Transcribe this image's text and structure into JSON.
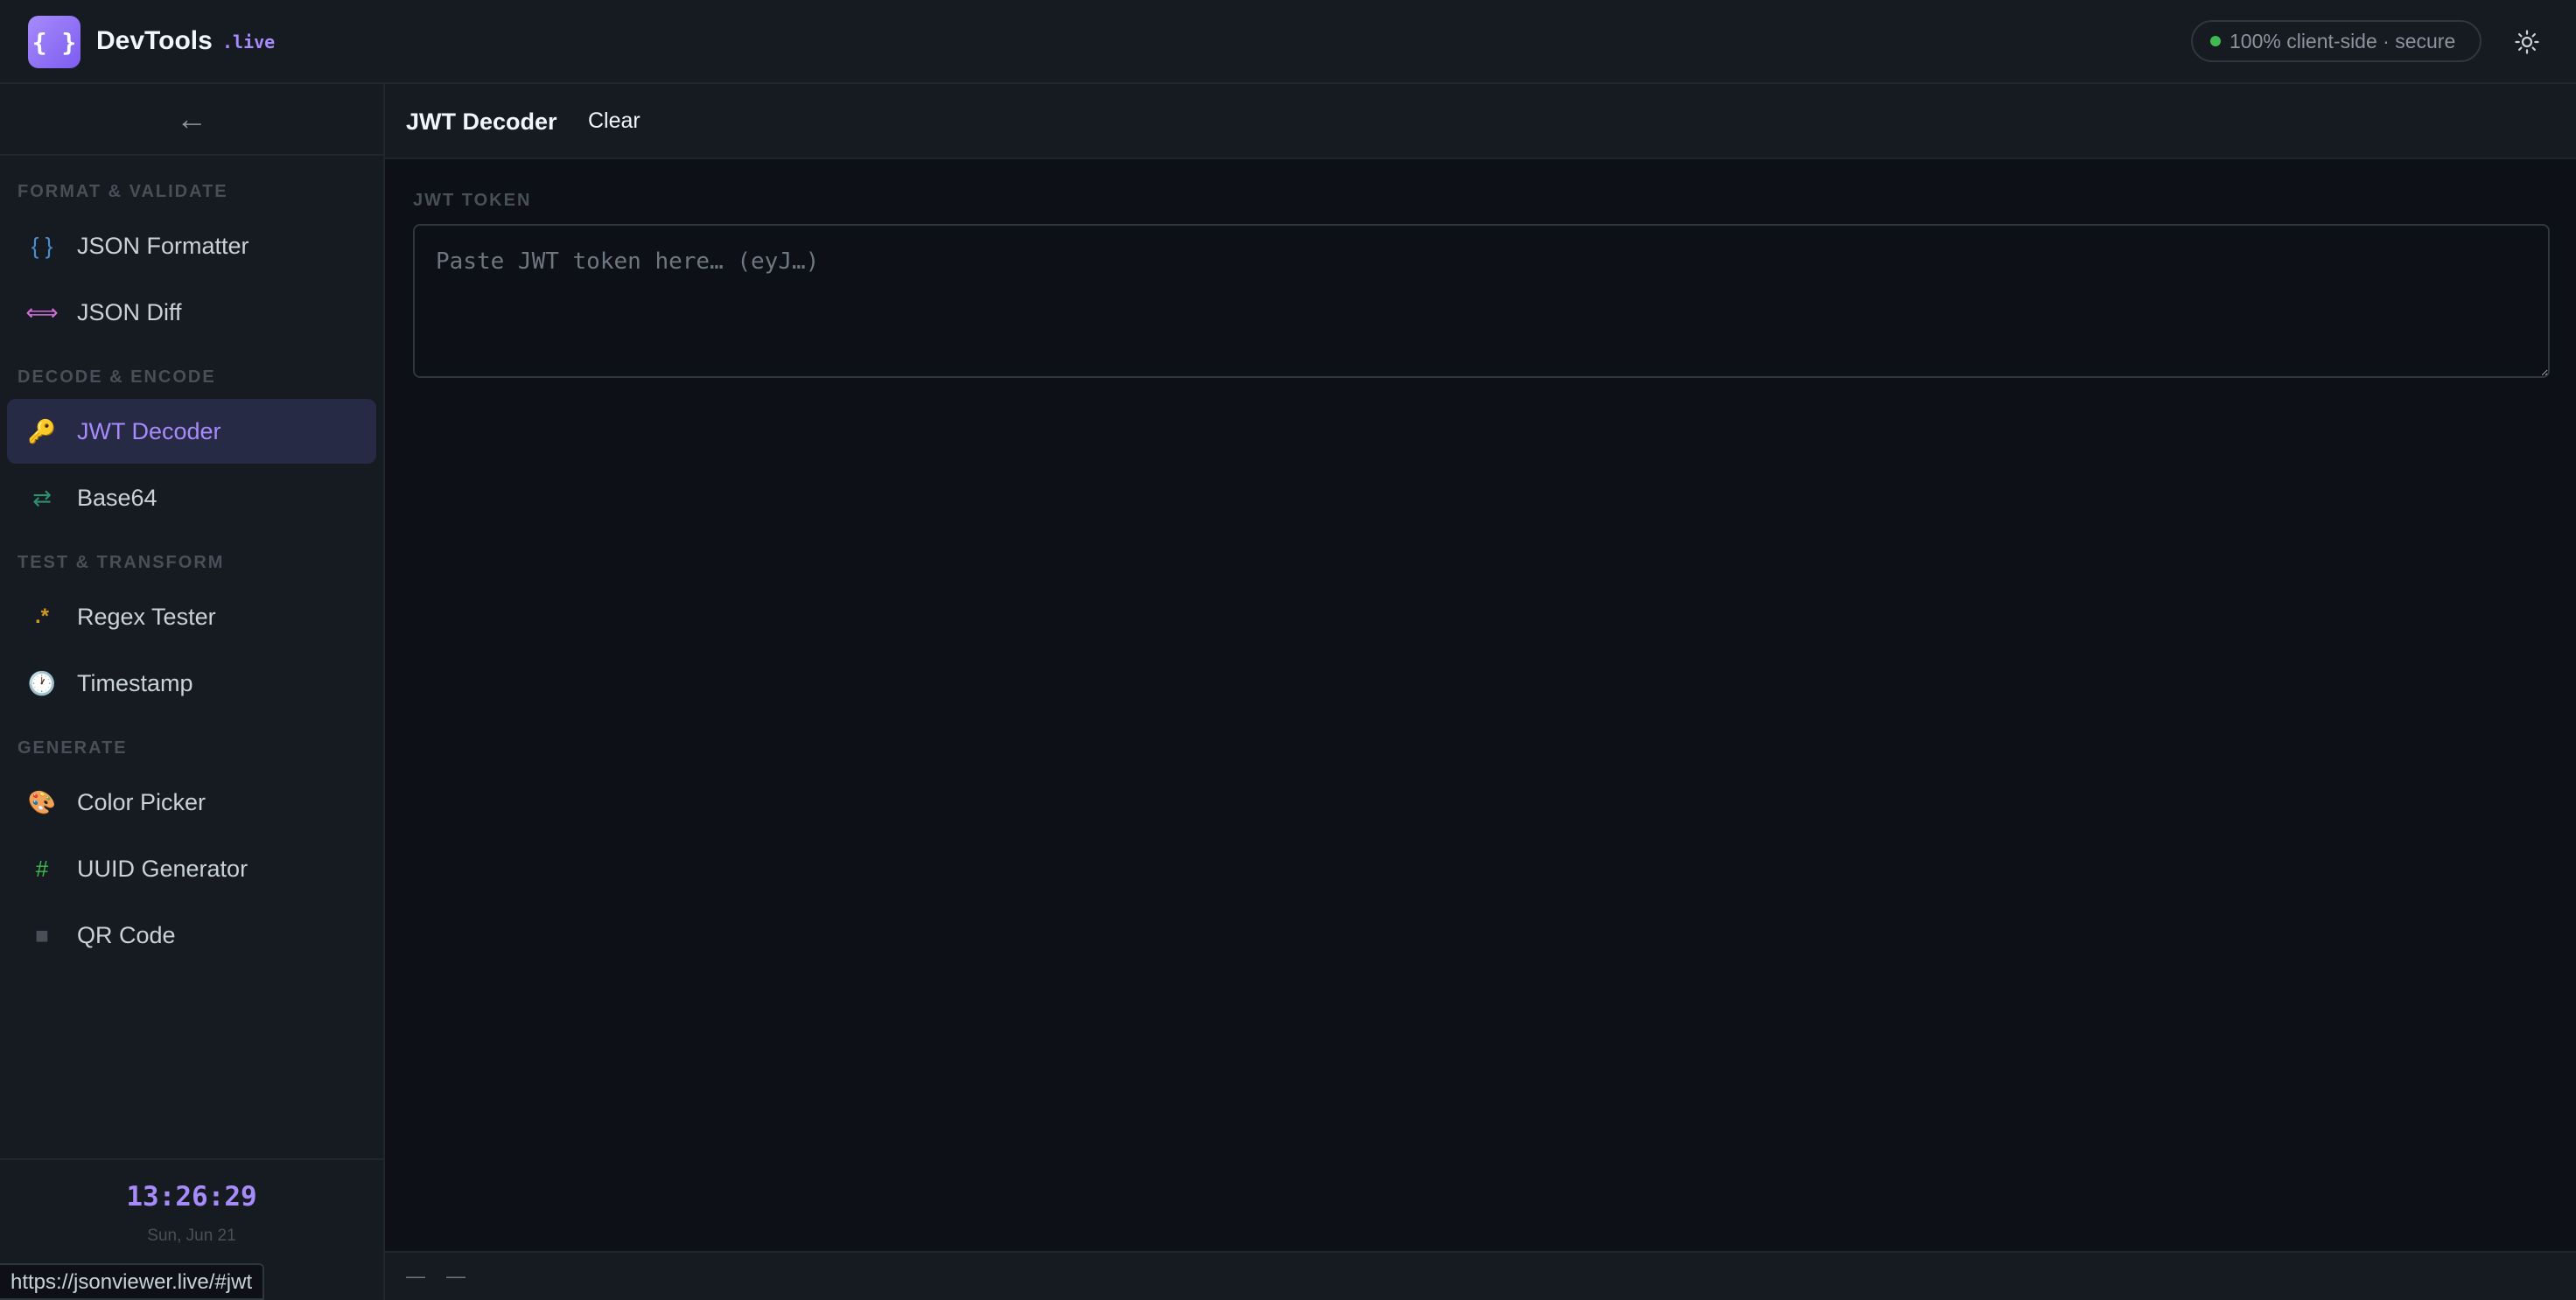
{
  "header": {
    "logo_glyph": "{ }",
    "brand": "DevTools",
    "brand_suffix": ".live",
    "secure_label": "100% client-side · secure",
    "secure_color": "#3fb950",
    "theme_icon": "sun-icon"
  },
  "sidebar": {
    "collapse_glyph": "←",
    "sections": [
      {
        "label": "FORMAT & VALIDATE"
      },
      {
        "label": "DECODE & ENCODE"
      },
      {
        "label": "TEST & TRANSFORM"
      },
      {
        "label": "GENERATE"
      }
    ],
    "items": [
      {
        "label": "JSON Formatter",
        "icon": "braces-icon",
        "glyph": "{ }",
        "color": "#4a8fd4"
      },
      {
        "label": "JSON Diff",
        "icon": "diff-arrows-icon",
        "glyph": "⟺",
        "color": "#d06fd6"
      },
      {
        "label": "JWT Decoder",
        "icon": "key-icon",
        "glyph": "🔑",
        "color": "#e3b341",
        "active": true
      },
      {
        "label": "Base64",
        "icon": "swap-arrows-icon",
        "glyph": "⇄",
        "color": "#2f8f6f"
      },
      {
        "label": "Regex Tester",
        "icon": "regex-icon",
        "glyph": ".*",
        "color": "#d29922"
      },
      {
        "label": "Timestamp",
        "icon": "clock-icon",
        "glyph": "🕐",
        "color": "#c9d1d9"
      },
      {
        "label": "Color Picker",
        "icon": "palette-icon",
        "glyph": "🎨",
        "color": "#e3b341"
      },
      {
        "label": "UUID Generator",
        "icon": "hash-icon",
        "glyph": "#",
        "color": "#3fb950"
      },
      {
        "label": "QR Code",
        "icon": "qr-square-icon",
        "glyph": "■",
        "color": "#484f58"
      }
    ],
    "clock": "13:26:29",
    "date": "Sun, Jun 21"
  },
  "toolbar": {
    "title": "JWT Decoder",
    "clear_label": "Clear"
  },
  "main": {
    "field_label": "JWT TOKEN",
    "input_placeholder": "Paste JWT token here… (eyJ…)",
    "input_value": ""
  },
  "statusbar": {
    "left": "—",
    "right": "—"
  },
  "url_hint": "https://jsonviewer.live/#jwt",
  "colors": {
    "accent": "#a78bfa",
    "background": "#0d1117",
    "panel": "#161b22",
    "active_item": "#262a45"
  }
}
